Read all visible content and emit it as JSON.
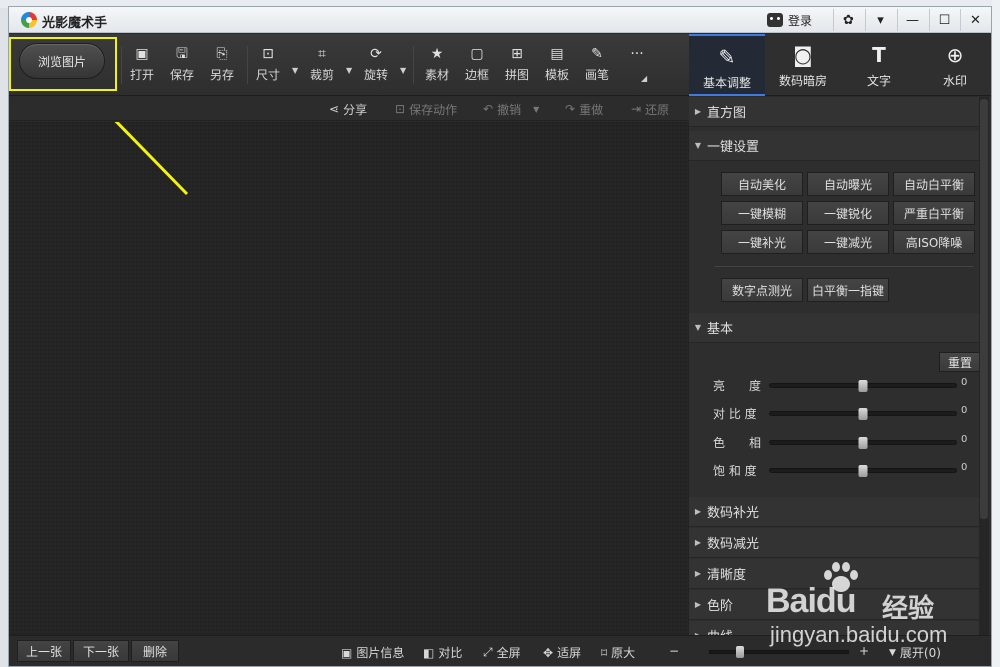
{
  "window": {
    "title": "光影魔术手",
    "login_label": "登录",
    "controls": [
      "✿",
      "▾",
      "—",
      "☐",
      "✕"
    ]
  },
  "toolbar": {
    "browse_label": "浏览图片",
    "tools": [
      {
        "label": "打开",
        "icon": "open-image-icon"
      },
      {
        "label": "保存",
        "icon": "save-icon"
      },
      {
        "label": "另存",
        "icon": "save-as-icon"
      },
      {
        "label": "尺寸",
        "icon": "resize-icon"
      },
      {
        "label": "裁剪",
        "icon": "crop-icon"
      },
      {
        "label": "旋转",
        "icon": "rotate-icon"
      },
      {
        "label": "素材",
        "icon": "material-icon"
      },
      {
        "label": "边框",
        "icon": "frame-icon"
      },
      {
        "label": "拼图",
        "icon": "collage-icon"
      },
      {
        "label": "模板",
        "icon": "template-icon"
      },
      {
        "label": "画笔",
        "icon": "brush-icon"
      }
    ],
    "more": "···"
  },
  "right_tabs": [
    {
      "label": "基本调整",
      "icon": "adjust-icon",
      "active": true
    },
    {
      "label": "数码暗房",
      "icon": "camera-icon",
      "active": false
    },
    {
      "label": "文字",
      "icon": "text-icon",
      "active": false
    },
    {
      "label": "水印",
      "icon": "watermark-icon",
      "active": false
    }
  ],
  "actions": {
    "share": "分享",
    "save_action": "保存动作",
    "undo": "撤销",
    "redo": "重做",
    "restore": "还原"
  },
  "panel": {
    "histogram": "直方图",
    "one_click": "一键设置",
    "quick_buttons": [
      "自动美化",
      "自动曝光",
      "自动白平衡",
      "一键模糊",
      "一键锐化",
      "严重白平衡",
      "一键补光",
      "一键减光",
      "高ISO降噪"
    ],
    "extra_buttons": [
      "数字点测光",
      "白平衡一指键"
    ],
    "basic": "基本",
    "reset": "重置",
    "sliders": [
      {
        "label": "亮　　度",
        "value": "0",
        "level": 0.5
      },
      {
        "label": "对 比 度",
        "value": "0",
        "level": 0.5
      },
      {
        "label": "色　　相",
        "value": "0",
        "level": 0.5
      },
      {
        "label": "饱 和 度",
        "value": "0",
        "level": 0.5
      }
    ],
    "sections": [
      "数码补光",
      "数码减光",
      "清晰度",
      "色阶",
      "曲线"
    ]
  },
  "bottom": {
    "prev": "上一张",
    "next": "下一张",
    "delete": "删除",
    "info": "图片信息",
    "compare": "对比",
    "fullscreen": "全屏",
    "fit": "适屏",
    "original": "原大",
    "zoom_minus": "−",
    "zoom_plus": "+",
    "expand": "展开(0)",
    "zoom_level": 0.22
  },
  "watermark": {
    "brand": "Bai",
    "brand_suffix": "du",
    "brand_cn": "经验",
    "url": "jingyan.baidu.com"
  },
  "colors": {
    "highlight": "#f3f312",
    "accent": "#3d7be0"
  }
}
